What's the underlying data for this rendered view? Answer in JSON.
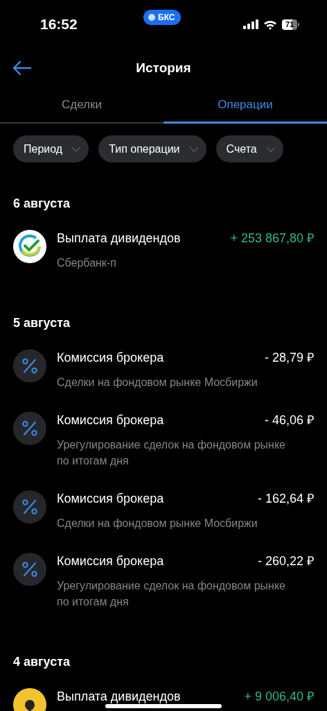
{
  "status_bar": {
    "time": "16:52",
    "app_pill": "БКС",
    "battery": "71"
  },
  "header": {
    "title": "История"
  },
  "tabs": [
    {
      "label": "Сделки",
      "selected": false
    },
    {
      "label": "Операции",
      "selected": true
    }
  ],
  "filters": [
    {
      "label": "Период"
    },
    {
      "label": "Тип операции"
    },
    {
      "label": "Счета"
    }
  ],
  "groups": [
    {
      "date": "6 августа",
      "items": [
        {
          "kind": "sber",
          "title": "Выплата дивидендов",
          "amount": "+ 253 867,80 ₽",
          "credit": true,
          "subtitle": "Сбербанк-п"
        }
      ]
    },
    {
      "date": "5 августа",
      "items": [
        {
          "kind": "percent",
          "title": "Комиссия брокера",
          "amount": "- 28,79 ₽",
          "credit": false,
          "subtitle": "Сделки на фондовом рынке Мосбиржи"
        },
        {
          "kind": "percent",
          "title": "Комиссия брокера",
          "amount": "- 46,06 ₽",
          "credit": false,
          "subtitle": "Урегулирование сделок на фондовом рынке по итогам дня"
        },
        {
          "kind": "percent",
          "title": "Комиссия брокера",
          "amount": "- 162,64 ₽",
          "credit": false,
          "subtitle": "Сделки на фондовом рынке Мосбиржи"
        },
        {
          "kind": "percent",
          "title": "Комиссия брокера",
          "amount": "- 260,22 ₽",
          "credit": false,
          "subtitle": "Урегулирование сделок на фондовом рынке по итогам дня"
        }
      ]
    },
    {
      "date": "4 августа",
      "items": [
        {
          "kind": "rosneft",
          "title": "Выплата дивидендов",
          "amount": "+ 9 006,40 ₽",
          "credit": true
        }
      ]
    }
  ]
}
